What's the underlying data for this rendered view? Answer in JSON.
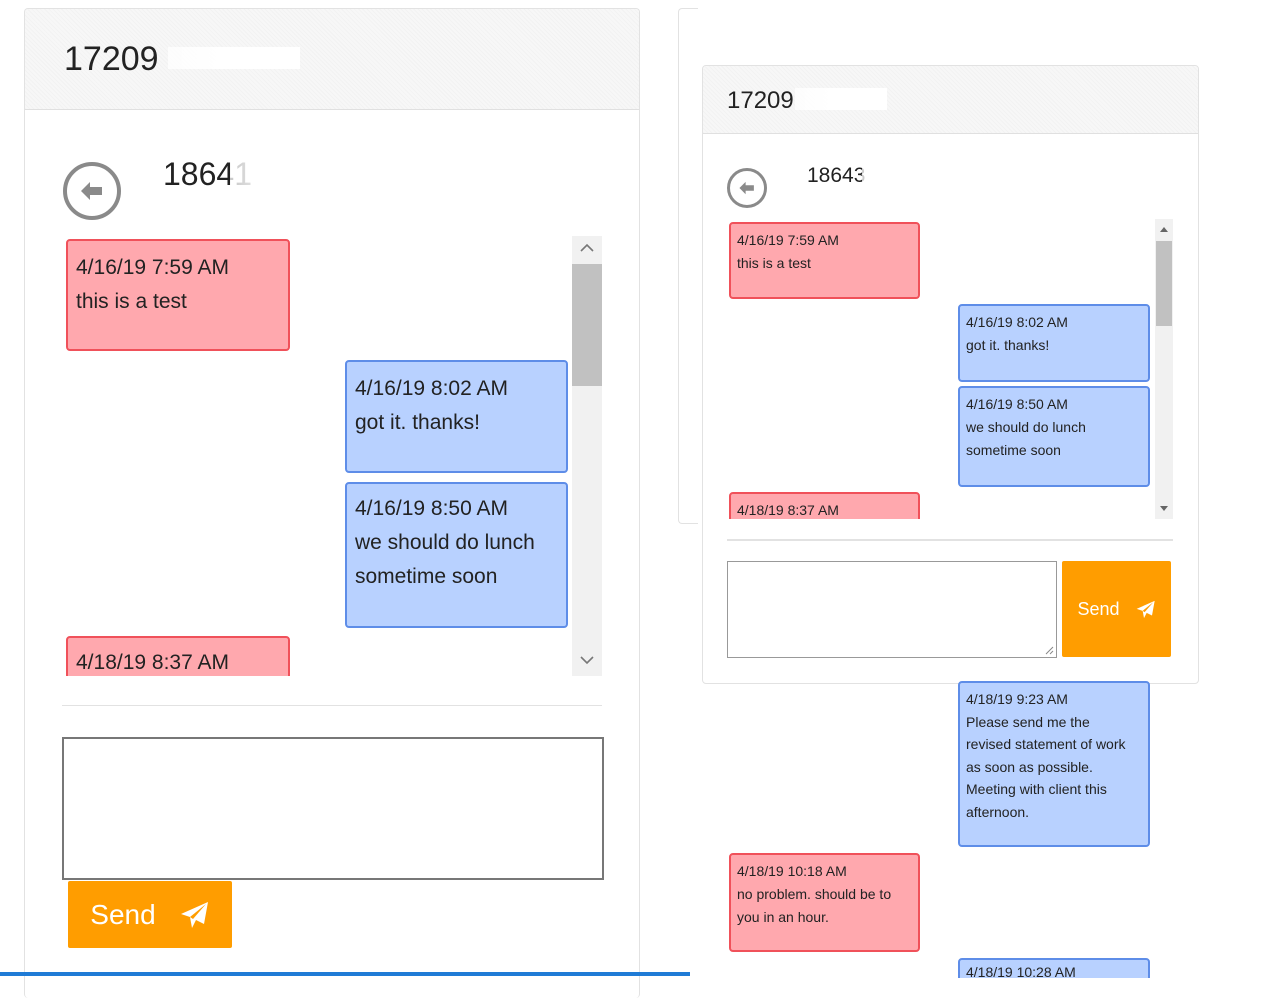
{
  "left": {
    "header_phone": "17209",
    "contact_phone": "18641",
    "send_label": "Send",
    "messages": [
      {
        "direction": "in",
        "time": "4/16/19 7:59 AM",
        "lines": [
          "this is a test"
        ]
      },
      {
        "direction": "out",
        "time": "4/16/19 8:02 AM",
        "lines": [
          "got it. thanks!"
        ]
      },
      {
        "direction": "out",
        "time": "4/16/19 8:50 AM",
        "lines": [
          "we should do lunch",
          "sometime soon"
        ]
      },
      {
        "direction": "in",
        "time": "4/18/19 8:37 AM",
        "lines": []
      }
    ]
  },
  "right": {
    "header_phone": "17209",
    "contact_phone": "18643",
    "send_label": "Send",
    "messages": [
      {
        "direction": "in",
        "time": "4/16/19 7:59 AM",
        "lines": [
          "this is a test"
        ]
      },
      {
        "direction": "out",
        "time": "4/16/19 8:02 AM",
        "lines": [
          "got it. thanks!"
        ]
      },
      {
        "direction": "out",
        "time": "4/16/19 8:50 AM",
        "lines": [
          "we should do lunch",
          "sometime soon"
        ]
      },
      {
        "direction": "in",
        "time": "4/18/19 8:37 AM",
        "lines": []
      }
    ],
    "overflow_messages": [
      {
        "direction": "out",
        "time": "4/18/19 9:23 AM",
        "lines": [
          "Please send me the",
          "revised statement of work",
          "as soon as possible.",
          "Meeting with client this",
          "afternoon."
        ]
      },
      {
        "direction": "in",
        "time": "4/18/19 10:18 AM",
        "lines": [
          "no problem. should be to",
          "you in an hour."
        ]
      },
      {
        "direction": "out",
        "time": "4/18/19 10:28 AM",
        "lines": []
      }
    ]
  },
  "colors": {
    "incoming_fill": "#ffa8ae",
    "incoming_border": "#f0515a",
    "outgoing_fill": "#b8d1ff",
    "outgoing_border": "#5e8de8",
    "send_button": "#ff9d00"
  },
  "icons": {
    "back": "arrow-left-circle-icon",
    "send": "paper-plane-icon",
    "scroll_up": "chevron-up-icon",
    "scroll_down": "chevron-down-icon"
  }
}
